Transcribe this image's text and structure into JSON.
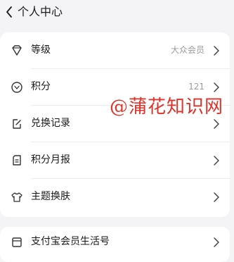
{
  "header": {
    "title": "个人中心"
  },
  "menu": [
    {
      "label": "等级",
      "value": "大众会员",
      "icon": "diamond-icon"
    },
    {
      "label": "积分",
      "value": "121",
      "icon": "points-coin-icon"
    },
    {
      "label": "兑换记录",
      "value": "",
      "icon": "edit-record-icon"
    },
    {
      "label": "积分月报",
      "value": "",
      "icon": "report-icon"
    },
    {
      "label": "主题换肤",
      "value": "",
      "icon": "tshirt-icon"
    }
  ],
  "menu2": [
    {
      "label": "支付宝会员生活号",
      "icon": "calendar-icon"
    }
  ],
  "watermark": "@蒲花知识网",
  "colors": {
    "background": "#f4f4f6",
    "card": "#ffffff",
    "muted": "#9a9a9a",
    "watermark": "#e0322a"
  }
}
